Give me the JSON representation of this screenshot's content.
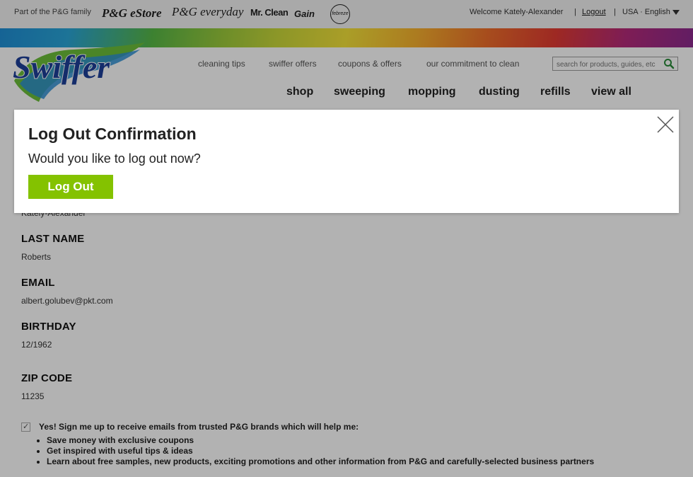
{
  "topbar": {
    "family_text": "Part of the P&G family",
    "brands": [
      "P&G eStore",
      "P&G everyday",
      "Mr. Clean",
      "Gain",
      "febreze"
    ],
    "welcome": "Welcome Kately-Alexander",
    "separator": "|",
    "logout": "Logout",
    "language": "USA · English"
  },
  "header": {
    "logo_text": "Swiffer",
    "util_links": [
      "cleaning tips",
      "swiffer offers",
      "coupons & offers",
      "our commitment to clean"
    ],
    "search_placeholder": "search for products, guides, etc",
    "nav": [
      "shop",
      "sweeping",
      "mopping",
      "dusting",
      "refills",
      "view all"
    ]
  },
  "profile": {
    "first_name_value": "Kately-Alexander",
    "last_name_label": "LAST NAME",
    "last_name_value": "Roberts",
    "email_label": "EMAIL",
    "email_value": "albert.golubev@pkt.com",
    "birthday_label": "BIRTHDAY",
    "birthday_value": "12/1962",
    "zip_label": "ZIP CODE",
    "zip_value": "11235",
    "optin_text": "Yes! Sign me up to receive emails from trusted P&G brands which will help me:",
    "optin_checked": true,
    "bullets": [
      "Save money with exclusive coupons",
      "Get inspired with useful tips & ideas",
      "Learn about free samples, new products, exciting promotions and other information from P&G and carefully-selected business partners"
    ]
  },
  "modal": {
    "title": "Log Out Confirmation",
    "message": "Would you like to log out now?",
    "button": "Log Out"
  },
  "colors": {
    "accent_green": "#84c200",
    "swiffer_blue": "#1d3f9a",
    "overlay": "rgba(0,0,0,0.3)"
  }
}
